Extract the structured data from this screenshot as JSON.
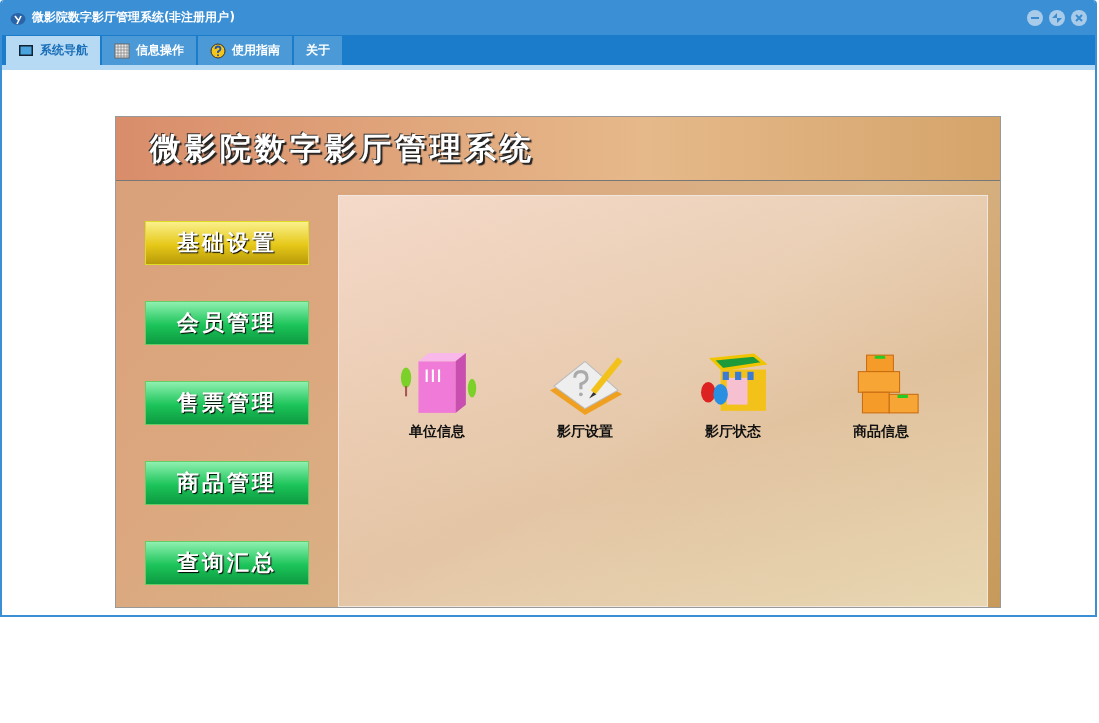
{
  "window": {
    "title": "微影院数字影厅管理系统(非注册用户)"
  },
  "tabs": [
    {
      "label": "系统导航",
      "kind": "monitor",
      "selected": true
    },
    {
      "label": "信息操作",
      "kind": "grid",
      "selected": false
    },
    {
      "label": "使用指南",
      "kind": "help",
      "selected": false
    },
    {
      "label": "关于",
      "kind": "plain",
      "selected": false
    }
  ],
  "banner": {
    "title": "微影院数字影厅管理系统"
  },
  "menu": [
    {
      "label": "基础设置",
      "selected": true
    },
    {
      "label": "会员管理",
      "selected": false
    },
    {
      "label": "售票管理",
      "selected": false
    },
    {
      "label": "商品管理",
      "selected": false
    },
    {
      "label": "查询汇总",
      "selected": false
    }
  ],
  "shortcuts": [
    {
      "label": "单位信息",
      "kind": "building"
    },
    {
      "label": "影厅设置",
      "kind": "notebook"
    },
    {
      "label": "影厅状态",
      "kind": "shop"
    },
    {
      "label": "商品信息",
      "kind": "boxes"
    }
  ]
}
